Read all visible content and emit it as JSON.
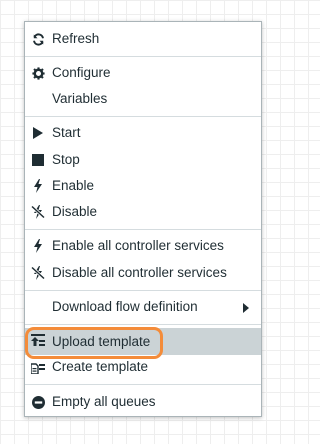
{
  "menu": {
    "items": [
      {
        "label": "Refresh",
        "icon": "refresh-icon"
      },
      {
        "label": "Configure",
        "icon": "gear-icon"
      },
      {
        "label": "Variables",
        "icon": ""
      },
      {
        "label": "Start",
        "icon": "play-icon"
      },
      {
        "label": "Stop",
        "icon": "stop-icon"
      },
      {
        "label": "Enable",
        "icon": "lightning-icon"
      },
      {
        "label": "Disable",
        "icon": "lightning-slash-icon"
      },
      {
        "label": "Enable all controller services",
        "icon": "lightning-icon"
      },
      {
        "label": "Disable all controller services",
        "icon": "lightning-slash-icon"
      },
      {
        "label": "Download flow definition",
        "icon": "",
        "has_submenu": true
      },
      {
        "label": "Upload template",
        "icon": "upload-template-icon",
        "state": "hovered"
      },
      {
        "label": "Create template",
        "icon": "create-template-icon"
      },
      {
        "label": "Empty all queues",
        "icon": "minus-circle-icon"
      }
    ],
    "highlight_color": "#cbd3d6",
    "outline_color": "#f48c3a"
  }
}
